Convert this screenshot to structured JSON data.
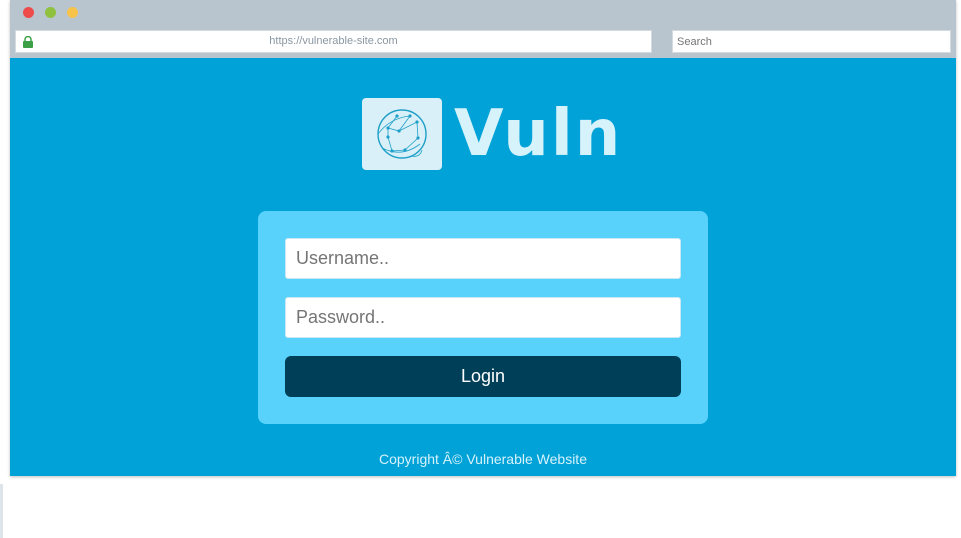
{
  "browser": {
    "traffic_lights": [
      {
        "name": "close",
        "color": "#ee4b4b"
      },
      {
        "name": "minimize",
        "color": "#8fc13f"
      },
      {
        "name": "maximize",
        "color": "#f7c34b"
      }
    ],
    "url": "https://vulnerable-site.com",
    "search_placeholder": "Search",
    "lock_color": "#3ea046"
  },
  "header": {
    "brand": "Vuln",
    "logo_icon": "network-globe-icon"
  },
  "login": {
    "username_placeholder": "Username..",
    "password_placeholder": "Password..",
    "button_label": "Login"
  },
  "footer": {
    "copyright": "Copyright Â© Vulnerable Website"
  },
  "colors": {
    "page_bg": "#00a2d8",
    "card_bg": "#58d2fb",
    "button_bg": "#003f58",
    "brand_text": "#d6f2fb"
  }
}
